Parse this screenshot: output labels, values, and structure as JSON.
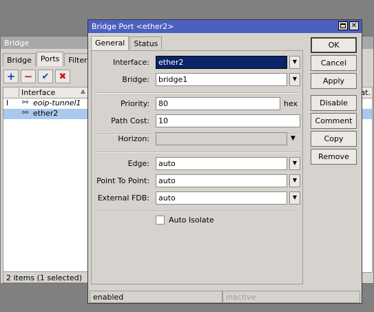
{
  "bridge_window": {
    "title": "Bridge",
    "tabs": [
      "Bridge",
      "Ports",
      "Filters"
    ],
    "active_tab": "Ports",
    "toolbar": {
      "add": "+",
      "remove": "−",
      "enable": "✔",
      "disable": "✖"
    },
    "table": {
      "header_interface": "Interface",
      "header_right": "at.",
      "rows": [
        {
          "flag": "I",
          "icon": "⚯",
          "name": "eoip-tunnel1"
        },
        {
          "flag": "",
          "icon": "⚯",
          "name": "ether2"
        }
      ]
    },
    "status": "2 items (1 selected)"
  },
  "dialog": {
    "title": "Bridge Port <ether2>",
    "tabs": [
      "General",
      "Status"
    ],
    "active_tab": "General",
    "fields": {
      "interface": {
        "label": "Interface:",
        "value": "ether2"
      },
      "bridge": {
        "label": "Bridge:",
        "value": "bridge1"
      },
      "priority": {
        "label": "Priority:",
        "value": "80",
        "unit": "hex"
      },
      "path_cost": {
        "label": "Path Cost:",
        "value": "10"
      },
      "horizon": {
        "label": "Horizon:",
        "value": ""
      },
      "edge": {
        "label": "Edge:",
        "value": "auto"
      },
      "point_to_point": {
        "label": "Point To Point:",
        "value": "auto"
      },
      "external_fdb": {
        "label": "External FDB:",
        "value": "auto"
      }
    },
    "auto_isolate": {
      "label": "Auto Isolate",
      "checked": false
    },
    "buttons": {
      "ok": "OK",
      "cancel": "Cancel",
      "apply": "Apply",
      "disable": "Disable",
      "comment": "Comment",
      "copy": "Copy",
      "remove": "Remove"
    },
    "status_left": "enabled",
    "status_right": "inactive"
  }
}
